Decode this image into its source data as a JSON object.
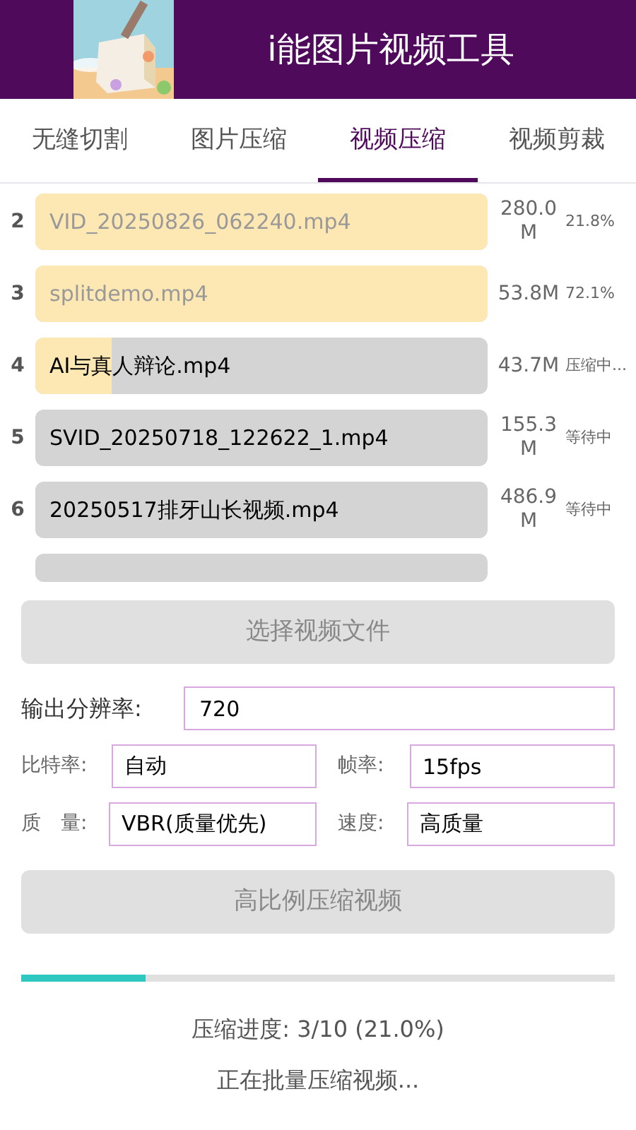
{
  "header": {
    "title": "i能图片视频工具"
  },
  "tabs": [
    {
      "label": "无缝切割",
      "selected": false
    },
    {
      "label": "图片压缩",
      "selected": false
    },
    {
      "label": "视频压缩",
      "selected": true
    },
    {
      "label": "视频剪裁",
      "selected": false
    }
  ],
  "files": [
    {
      "index": "2",
      "name": "VID_20250826_062240.mp4",
      "size": "280.0 M",
      "status": "21.8%",
      "kind": "done",
      "level": 1
    },
    {
      "index": "3",
      "name": "splitdemo.mp4",
      "size": "53.8M",
      "status": "72.1%",
      "kind": "done",
      "level": 1
    },
    {
      "index": "4",
      "name": "AI与真人辩论.mp4",
      "size": "43.7M",
      "status": "压缩中...",
      "kind": "active",
      "level": 0.17
    },
    {
      "index": "5",
      "name": "SVID_20250718_122622_1.mp4",
      "size": "155.3 M",
      "status": "等待中",
      "kind": "waiting",
      "level": 0
    },
    {
      "index": "6",
      "name": "20250517排牙山长视频.mp4",
      "size": "486.9 M",
      "status": "等待中",
      "kind": "waiting",
      "level": 0
    }
  ],
  "select_button": "选择视频文件",
  "settings": {
    "resolution": {
      "label": "输出分辨率:",
      "value": "720"
    },
    "bitrate": {
      "label": "比特率:",
      "value": "自动"
    },
    "framerate": {
      "label": "帧率:",
      "value": "15fps"
    },
    "quality": {
      "label": "质　量:",
      "value": "VBR(质量优先)"
    },
    "speed": {
      "label": "速度:",
      "value": "高质量"
    }
  },
  "compress_button": "高比例压缩视频",
  "progress": {
    "level": 0.21,
    "label": "压缩进度: 3/10 (21.0%)",
    "message": "正在批量压缩视频..."
  }
}
